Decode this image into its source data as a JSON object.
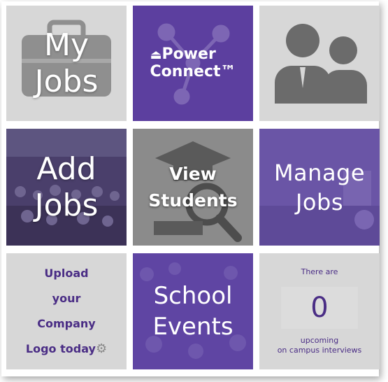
{
  "tiles": {
    "my_jobs": {
      "line1": "My",
      "line2": "Jobs"
    },
    "power_connect": {
      "line1": "Power",
      "line2": "Connect™"
    },
    "profile": {},
    "add_jobs": {
      "line1": "Add",
      "line2": "Jobs"
    },
    "view_students": {
      "line1": "View",
      "line2": "Students"
    },
    "manage_jobs": {
      "line1": "Manage",
      "line2": "Jobs"
    },
    "upload_logo": {
      "line1": "Upload",
      "line2": "your",
      "line3": "Company",
      "line4": "Logo today"
    },
    "school_events": {
      "line1": "School",
      "line2": "Events"
    },
    "interviews": {
      "prefix": "There are",
      "count": "0",
      "suffix1": "upcoming",
      "suffix2": "on campus interviews"
    }
  },
  "colors": {
    "purple": "#5c3f9f",
    "gray": "#d7d7d7",
    "text_purple": "#4a2d85"
  },
  "icons": [
    "briefcase-icon",
    "network-icon",
    "people-icon",
    "graduation-magnifier-icon",
    "gear-icon"
  ]
}
